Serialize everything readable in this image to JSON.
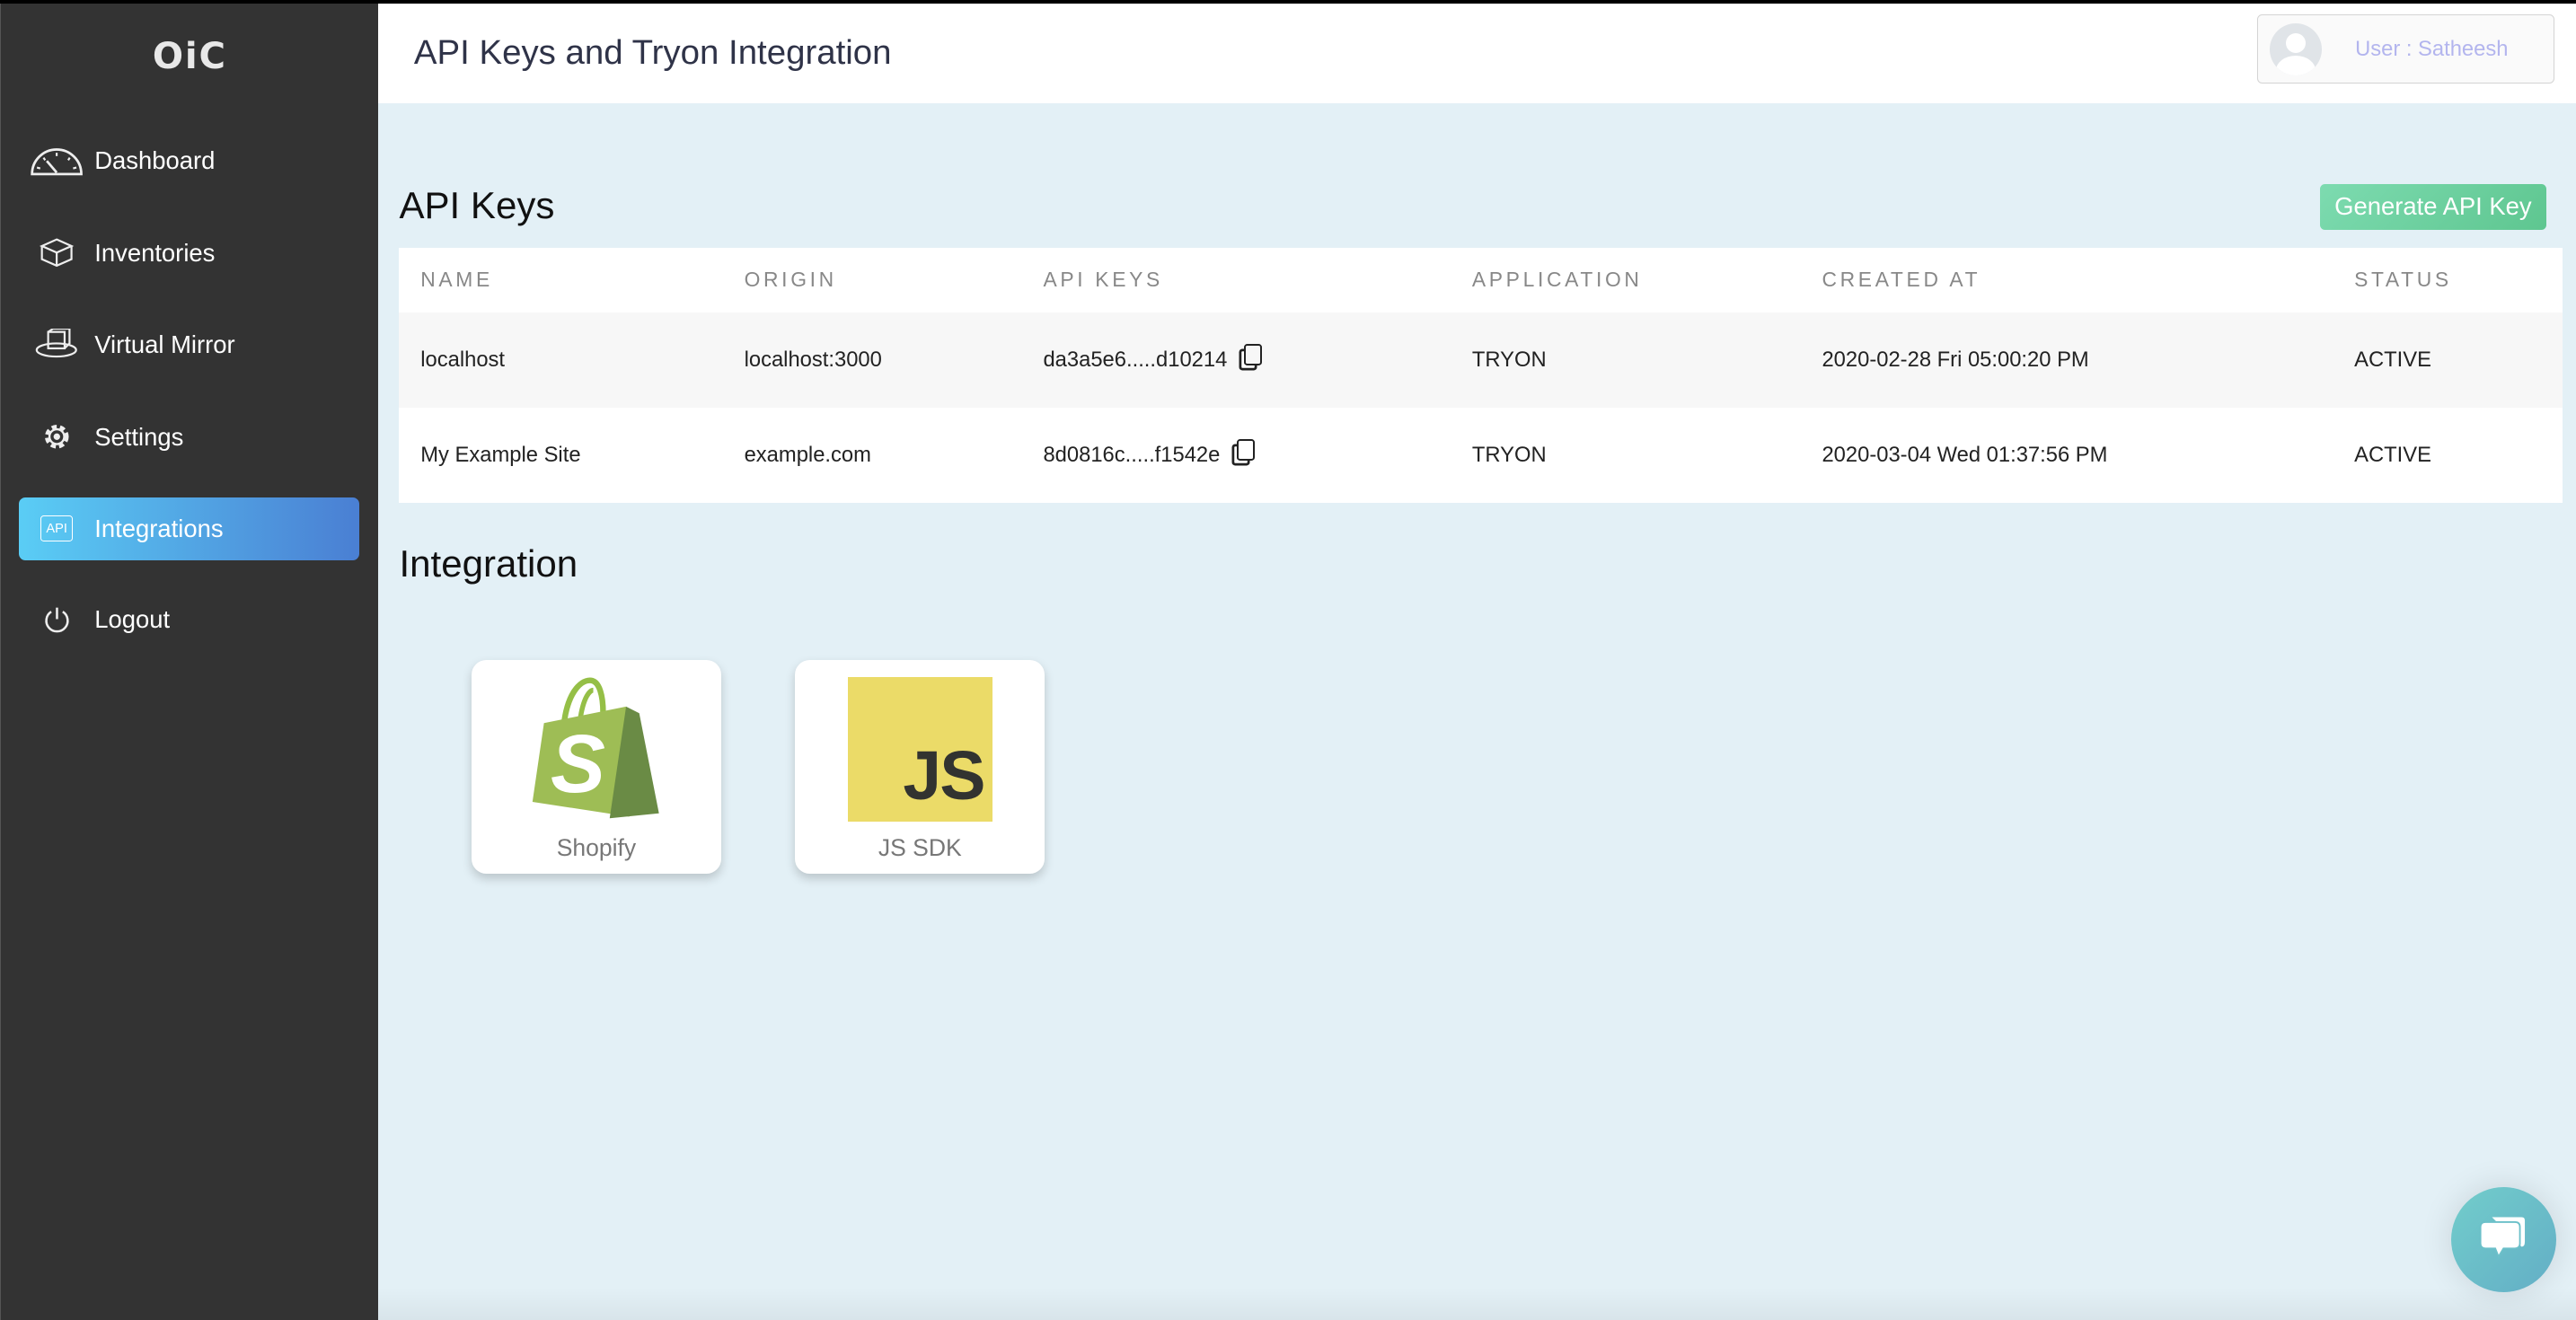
{
  "sidebar": {
    "logo": "OiC",
    "items": [
      {
        "label": "Dashboard",
        "icon": "speedometer-icon"
      },
      {
        "label": "Inventories",
        "icon": "box-icon"
      },
      {
        "label": "Virtual Mirror",
        "icon": "rotate-cube-icon"
      },
      {
        "label": "Settings",
        "icon": "gear-icon"
      },
      {
        "label": "Integrations",
        "icon": "api-icon",
        "active": true,
        "badge": "API"
      },
      {
        "label": "Logout",
        "icon": "power-icon"
      }
    ]
  },
  "header": {
    "title": "API Keys and Tryon Integration",
    "user": "User : Satheesh"
  },
  "api_keys": {
    "title": "API Keys",
    "generate_label": "Generate API Key",
    "columns": [
      "NAME",
      "ORIGIN",
      "API KEYS",
      "APPLICATION",
      "CREATED AT",
      "STATUS"
    ],
    "rows": [
      [
        "localhost",
        "localhost:3000",
        "da3a5e6.....d10214",
        "TRYON",
        "2020-02-28 Fri 05:00:20 PM",
        "ACTIVE"
      ],
      [
        "My Example Site",
        "example.com",
        "8d0816c.....f1542e",
        "TRYON",
        "2020-03-04 Wed 01:37:56 PM",
        "ACTIVE"
      ]
    ]
  },
  "integration": {
    "title": "Integration",
    "cards": [
      {
        "label": "Shopify",
        "icon": "shopify-icon"
      },
      {
        "label": "JS SDK",
        "icon": "js-icon",
        "logo_text": "JS"
      }
    ]
  },
  "colors": {
    "sidebar": "#333333",
    "accent_gradient": [
      "#5acdf5",
      "#4a7fd3"
    ],
    "button": "#6dd3a3",
    "background": "#e3f0f6"
  }
}
